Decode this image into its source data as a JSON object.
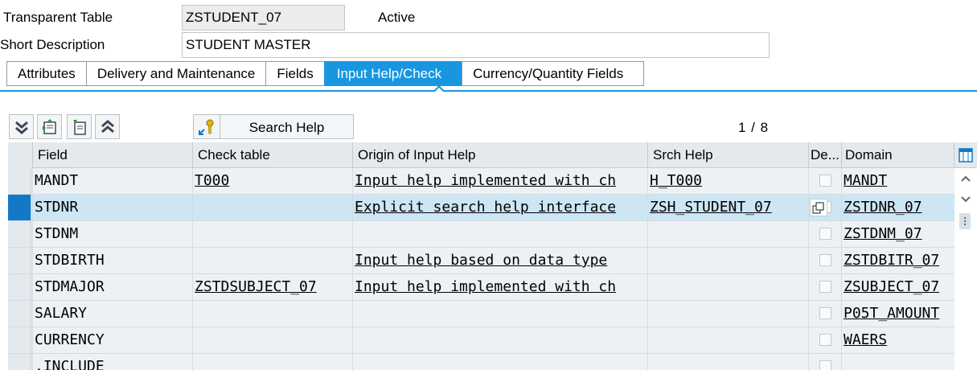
{
  "header": {
    "table_type_label": "Transparent Table",
    "table_name": "ZSTUDENT_07",
    "status": "Active",
    "short_desc_label": "Short Description",
    "short_desc_value": "STUDENT MASTER"
  },
  "tabs": [
    {
      "label": "Attributes",
      "active": false
    },
    {
      "label": "Delivery and Maintenance",
      "active": false
    },
    {
      "label": "Fields",
      "active": false
    },
    {
      "label": "Input Help/Check",
      "active": true
    },
    {
      "label": "Currency/Quantity Fields",
      "active": false
    }
  ],
  "toolbar": {
    "icons": [
      "expand-all-icon",
      "insert-row-icon",
      "delete-row-icon",
      "collapse-all-icon",
      "search-help-key-icon"
    ],
    "search_help_label": "Search Help",
    "pager": "1 / 8"
  },
  "columns": [
    "Field",
    "Check table",
    "Origin of Input Help",
    "Srch Help",
    "De...",
    "Domain"
  ],
  "rows": [
    {
      "field": "MANDT",
      "check_table": "T000",
      "origin": "Input help implemented with ch",
      "srch_help": "H_T000",
      "domain": "MANDT",
      "selected": false
    },
    {
      "field": "STDNR",
      "check_table": "",
      "origin": "Explicit search help interface",
      "srch_help": "ZSH_STUDENT_07",
      "domain": "ZSTDNR_07",
      "selected": true
    },
    {
      "field": "STDNM",
      "check_table": "",
      "origin": "",
      "srch_help": "",
      "domain": "ZSTDNM_07",
      "selected": false
    },
    {
      "field": "STDBIRTH",
      "check_table": "",
      "origin": "Input help based on data type",
      "srch_help": "",
      "domain": "ZSTDBITR_07",
      "selected": false
    },
    {
      "field": "STDMAJOR",
      "check_table": "ZSTDSUBJECT_07",
      "origin": "Input help implemented with ch",
      "srch_help": "",
      "domain": "ZSUBJECT_07",
      "selected": false
    },
    {
      "field": "SALARY",
      "check_table": "",
      "origin": "",
      "srch_help": "",
      "domain": "P05T_AMOUNT",
      "selected": false
    },
    {
      "field": "CURRENCY",
      "check_table": "",
      "origin": "",
      "srch_help": "",
      "domain": "WAERS",
      "selected": false
    },
    {
      "field": ".INCLUDE",
      "check_table": "",
      "origin": "",
      "srch_help": "",
      "domain": "",
      "selected": false
    }
  ],
  "colors": {
    "accent": "#1996e0",
    "selected_row": "#cde6f4",
    "alt_row": "#eef1f3",
    "focus": "#d0021b"
  }
}
